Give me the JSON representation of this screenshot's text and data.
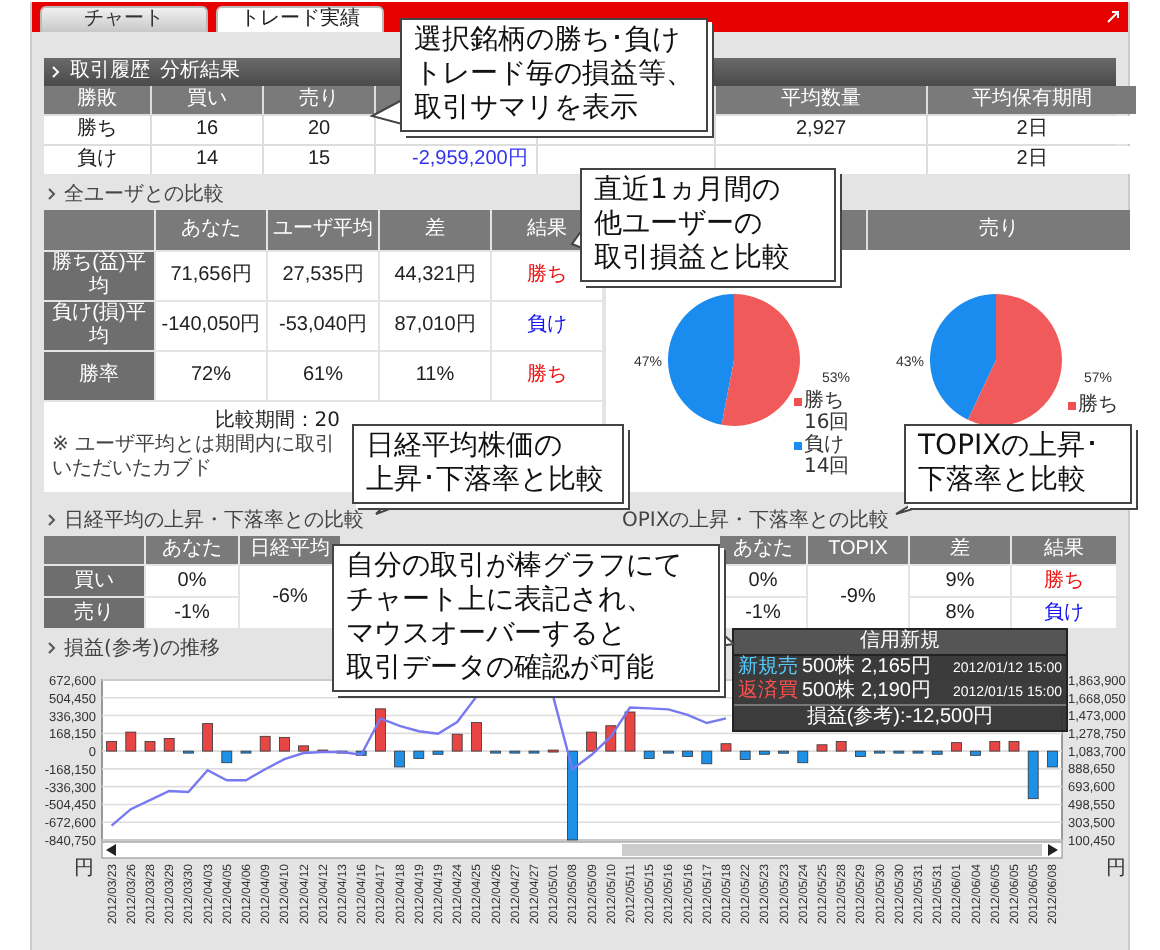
{
  "tabs": [
    {
      "label": "チャート",
      "selected": false
    },
    {
      "label": "トレード実績",
      "selected": true
    }
  ],
  "summary": {
    "title": "取引履歴",
    "subtitle": "分析結果",
    "columns": {
      "result": "勝敗",
      "buy": "買い",
      "sell": "売り",
      "avg_qty": "平均数量",
      "avg_hold": "平均保有期間"
    },
    "rows": [
      {
        "result": "勝ち",
        "buy": "16",
        "sell": "20",
        "avg_qty": "2,927",
        "avg_hold": "2日"
      },
      {
        "result": "負け",
        "buy": "14",
        "sell": "15",
        "column_4": "-2,959,200円",
        "avg_hold": "2日"
      }
    ]
  },
  "user_comparison": {
    "title": "全ユーザとの比較",
    "columns": [
      "あなた",
      "ユーザ平均",
      "差",
      "結果"
    ],
    "rows": [
      {
        "label": "勝ち(益)平均",
        "cells": [
          "71,656円",
          "27,535円",
          "44,321円"
        ],
        "result": "勝ち",
        "won": true
      },
      {
        "label": "負け(損)平均",
        "cells": [
          "-140,050円",
          "-53,040円",
          "87,010円"
        ],
        "result": "負け",
        "won": false
      },
      {
        "label": "勝率",
        "cells": [
          "72%",
          "61%",
          "11%"
        ],
        "result": "勝ち",
        "won": true
      }
    ],
    "period": "比較期間：20",
    "note": "※ ユーザ平均とは期間内に取引いただいたカブド"
  },
  "pies": [
    {
      "legend": [
        {
          "label": "勝ち",
          "count": "16回",
          "color": "#f05050"
        },
        {
          "label": "負け",
          "count": "14回",
          "color": "#1a8cf0"
        }
      ],
      "chart_data": {
        "type": "pie",
        "values": [
          47,
          53
        ],
        "value_labels": [
          "47%",
          "53%"
        ],
        "colors": [
          "#1a8cf0",
          "#f05a5a"
        ]
      }
    },
    {
      "header": "売り",
      "legend": [
        {
          "label": "勝ち",
          "color": "#f05050"
        }
      ],
      "chart_data": {
        "type": "pie",
        "values": [
          43,
          57
        ],
        "value_labels": [
          "43%",
          "57%"
        ],
        "colors": [
          "#1a8cf0",
          "#f05a5a"
        ]
      }
    }
  ],
  "nikkei": {
    "title": "日経平均の上昇・下落率との比較",
    "columns": [
      "あなた",
      "日経平均"
    ],
    "rows": [
      {
        "label": "買い",
        "you": "0%"
      },
      {
        "label": "売り",
        "you": "-1%"
      }
    ],
    "index_change": "-6%"
  },
  "topix": {
    "title": "OPIXの上昇・下落率との比較",
    "columns": [
      "あなた",
      "TOPIX",
      "差",
      "結果"
    ],
    "rows": [
      {
        "you": "0%",
        "diff": "9%",
        "result": "勝ち",
        "won": true
      },
      {
        "you": "-1%",
        "diff": "8%",
        "result": "負け",
        "won": false
      }
    ],
    "index_change": "-9%"
  },
  "profit_history": {
    "title": "損益(参考)の推移",
    "chart_data": {
      "type": "bar",
      "grid": true,
      "ylabel": "円",
      "y2label": "円",
      "ylim": [
        -840750,
        672600
      ],
      "y2lim": [
        100450,
        1863900
      ],
      "yticks": [
        {
          "value": 672600,
          "label": "672,600"
        },
        {
          "value": 504450,
          "label": "504,450"
        },
        {
          "value": 336300,
          "label": "336,300"
        },
        {
          "value": 168150,
          "label": "168,150"
        },
        {
          "value": 0,
          "label": "0"
        },
        {
          "value": -168150,
          "label": "-168,150"
        },
        {
          "value": -336300,
          "label": "-336,300"
        },
        {
          "value": -504450,
          "label": "-504,450"
        },
        {
          "value": -672600,
          "label": "-672,600"
        },
        {
          "value": -840750,
          "label": "-840,750"
        }
      ],
      "y2ticks": [
        {
          "value": 1863900,
          "label": "1,863,900"
        },
        {
          "value": 1668050,
          "label": "1,668,050"
        },
        {
          "value": 1473000,
          "label": "1,473,000"
        },
        {
          "value": 1278750,
          "label": "1,278,750"
        },
        {
          "value": 1083700,
          "label": "1,083,700"
        },
        {
          "value": 888650,
          "label": "888,650"
        },
        {
          "value": 693600,
          "label": "693,600"
        },
        {
          "value": 498550,
          "label": "498,550"
        },
        {
          "value": 303500,
          "label": "303,500"
        },
        {
          "value": 100450,
          "label": "100,450"
        }
      ],
      "categories": [
        "2012/03/23",
        "2012/03/26",
        "2012/03/28",
        "2012/03/29",
        "2012/03/30",
        "2012/04/03",
        "2012/04/05",
        "2012/04/06",
        "2012/04/09",
        "2012/04/10",
        "2012/04/12",
        "2012/04/12",
        "2012/04/13",
        "2012/04/16",
        "2012/04/17",
        "2012/04/18",
        "2012/04/19",
        "2012/04/19",
        "2012/04/24",
        "2012/04/25",
        "2012/04/26",
        "2012/04/27",
        "2012/04/27",
        "2012/05/01",
        "2012/05/08",
        "2012/05/09",
        "2012/05/10",
        "2012/05/11",
        "2012/05/15",
        "2012/05/16",
        "2012/05/16",
        "2012/05/17",
        "2012/05/18",
        "2012/05/22",
        "2012/05/23",
        "2012/05/23",
        "2012/05/24",
        "2012/05/25",
        "2012/05/28",
        "2012/05/29",
        "2012/05/30",
        "2012/05/30",
        "2012/05/31",
        "2012/05/31",
        "2012/06/01",
        "2012/06/04",
        "2012/06/05",
        "2012/06/05",
        "2012/06/05",
        "2012/06/08"
      ],
      "series": [
        {
          "color": "#e84545",
          "values": [
            90000,
            180000,
            90000,
            120000,
            null,
            260000,
            null,
            null,
            140000,
            130000,
            50000,
            10000,
            0,
            null,
            400000,
            null,
            null,
            null,
            160000,
            270000,
            null,
            null,
            null,
            10000,
            null,
            180000,
            240000,
            370000,
            null,
            null,
            null,
            null,
            70000,
            null,
            null,
            null,
            null,
            60000,
            90000,
            null,
            null,
            null,
            null,
            null,
            80000,
            null,
            90000,
            90000,
            null,
            null
          ]
        },
        {
          "color": "#1e90e8",
          "values": [
            null,
            null,
            null,
            null,
            -10000,
            null,
            -110000,
            -10000,
            null,
            null,
            null,
            null,
            null,
            -40000,
            null,
            -150000,
            -70000,
            -30000,
            null,
            null,
            -10000,
            -10000,
            -10000,
            null,
            -840000,
            null,
            null,
            null,
            -70000,
            -10000,
            -50000,
            -120000,
            null,
            -80000,
            -30000,
            -20000,
            -110000,
            null,
            null,
            -50000,
            -10000,
            -10000,
            -10000,
            -30000,
            null,
            -40000,
            null,
            null,
            -450000,
            -150000
          ]
        },
        {
          "type": "line",
          "axis": "y2",
          "color": "#7878f0",
          "values": [
            260000,
            440000,
            540000,
            640000,
            630000,
            870000,
            760000,
            760000,
            880000,
            990000,
            1060000,
            1070000,
            1070000,
            1040000,
            1440000,
            1360000,
            1300000,
            1270000,
            1400000,
            1680000,
            null,
            null,
            null,
            1680000,
            880000,
            1040000,
            1240000,
            1560000,
            1550000,
            1540000,
            1480000,
            1390000,
            1440000,
            null,
            null,
            null,
            null,
            null,
            null,
            null,
            null,
            null,
            null,
            null,
            null,
            null,
            null,
            null,
            null,
            null
          ]
        }
      ]
    }
  },
  "tooltip": {
    "title": "信用新規",
    "rows": [
      {
        "kind": "open",
        "side": "新規売",
        "detail": "500株 2,165円",
        "time": "2012/01/12 15:00"
      },
      {
        "kind": "close",
        "side": "返済買",
        "detail": "500株 2,190円",
        "time": "2012/01/15 15:00"
      }
    ],
    "profit": "損益(参考):-12,500円"
  },
  "callouts": [
    {
      "lines": [
        "選択銘柄の勝ち･負け",
        "トレード毎の損益等、",
        "取引サマリを表示"
      ]
    },
    {
      "lines": [
        "直近1ヵ月間の",
        "他ユーザーの",
        "取引損益と比較"
      ]
    },
    {
      "lines": [
        "日経平均株価の",
        "上昇･下落率と比較"
      ]
    },
    {
      "lines": [
        "TOPIXの上昇･",
        "下落率と比較"
      ]
    },
    {
      "lines": [
        "自分の取引が棒グラフにて",
        "チャート上に表記され、",
        "マウスオーバーすると",
        "取引データの確認が可能"
      ]
    }
  ]
}
